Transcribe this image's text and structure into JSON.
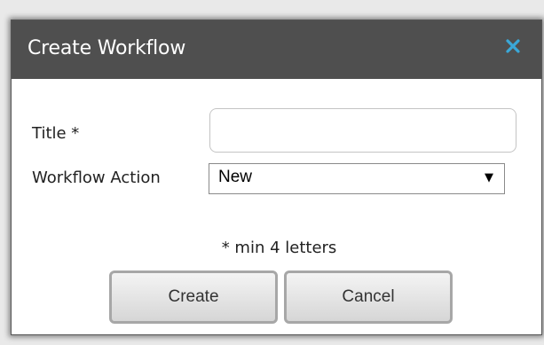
{
  "dialog": {
    "title": "Create Workflow",
    "close_icon": "close-icon",
    "colors": {
      "titlebar": "#4f4f4f",
      "close_icon": "#3aa8d8"
    }
  },
  "form": {
    "title_label": "Title *",
    "title_value": "",
    "action_label": "Workflow Action",
    "action_selected": "New",
    "note": "* min 4 letters"
  },
  "buttons": {
    "create": "Create",
    "cancel": "Cancel"
  }
}
